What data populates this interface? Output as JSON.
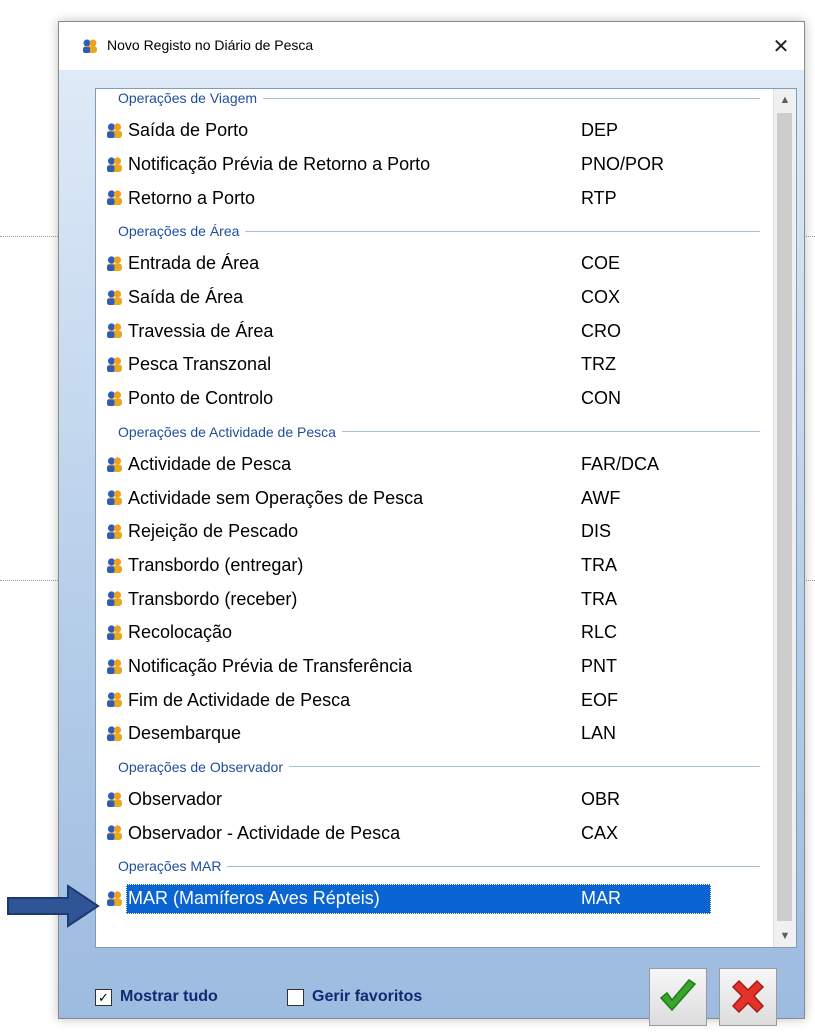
{
  "window": {
    "title": "Novo Registo no Diário de Pesca",
    "close_glyph": "✕"
  },
  "sections": [
    {
      "label": "Operações de Viagem",
      "items": [
        {
          "label": "Saída de Porto",
          "code": "DEP"
        },
        {
          "label": "Notificação Prévia de Retorno a Porto",
          "code": "PNO/POR"
        },
        {
          "label": "Retorno a Porto",
          "code": "RTP"
        }
      ]
    },
    {
      "label": "Operações de Área",
      "items": [
        {
          "label": "Entrada de Área",
          "code": "COE"
        },
        {
          "label": "Saída de Área",
          "code": "COX"
        },
        {
          "label": "Travessia de Área",
          "code": "CRO"
        },
        {
          "label": "Pesca Transzonal",
          "code": "TRZ"
        },
        {
          "label": "Ponto de Controlo",
          "code": "CON"
        }
      ]
    },
    {
      "label": "Operações de Actividade de Pesca",
      "items": [
        {
          "label": "Actividade de Pesca",
          "code": "FAR/DCA"
        },
        {
          "label": "Actividade sem Operações de Pesca",
          "code": "AWF"
        },
        {
          "label": "Rejeição de Pescado",
          "code": "DIS"
        },
        {
          "label": "Transbordo (entregar)",
          "code": "TRA"
        },
        {
          "label": "Transbordo (receber)",
          "code": "TRA"
        },
        {
          "label": "Recolocação",
          "code": "RLC"
        },
        {
          "label": "Notificação Prévia de Transferência",
          "code": "PNT"
        },
        {
          "label": "Fim de Actividade de Pesca",
          "code": "EOF"
        },
        {
          "label": "Desembarque",
          "code": "LAN"
        }
      ]
    },
    {
      "label": "Operações de Observador",
      "items": [
        {
          "label": "Observador",
          "code": "OBR"
        },
        {
          "label": "Observador - Actividade de Pesca",
          "code": "CAX"
        }
      ]
    },
    {
      "label": "Operações MAR",
      "items": [
        {
          "label": "MAR (Mamíferos Aves Répteis)",
          "code": "MAR",
          "selected": true
        }
      ]
    }
  ],
  "options": {
    "show_all": {
      "label": "Mostrar tudo",
      "checked": true
    },
    "manage_favorites": {
      "label": "Gerir favoritos",
      "checked": false
    }
  },
  "colors": {
    "selection": "#0a64d2",
    "group_header": "#1e4e9c",
    "ok_check": "#3aa52b",
    "cancel_x": "#e3322a",
    "annotation_arrow": "#2f5597"
  },
  "icons": {
    "item_icon": "users-icon",
    "ok": "checkmark-icon",
    "cancel": "x-icon",
    "annotation": "arrow-right-icon"
  }
}
